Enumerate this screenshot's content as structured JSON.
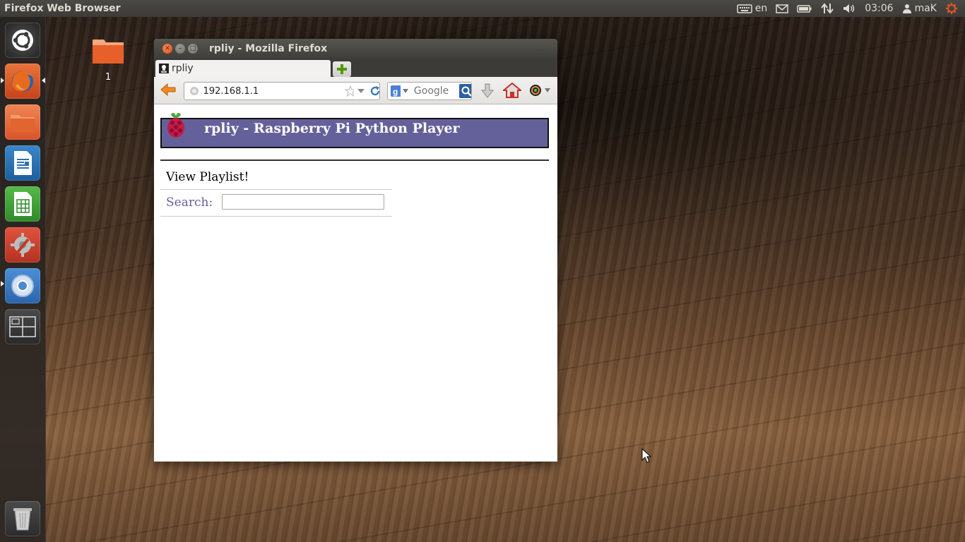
{
  "top_panel": {
    "app_name": "Firefox Web Browser",
    "keyboard_layout": "en",
    "time": "03:06",
    "user": "maK"
  },
  "launcher": {
    "items": [
      {
        "name": "dash-home",
        "running": false
      },
      {
        "name": "firefox",
        "running": true,
        "focused": true
      },
      {
        "name": "files",
        "running": false
      },
      {
        "name": "libreoffice-writer",
        "running": false
      },
      {
        "name": "libreoffice-calc",
        "running": false
      },
      {
        "name": "system-settings",
        "running": false
      },
      {
        "name": "chromium",
        "running": true
      },
      {
        "name": "workspace-switcher",
        "running": false
      },
      {
        "name": "trash",
        "running": false
      }
    ]
  },
  "desktop": {
    "folder_label": "1"
  },
  "window": {
    "title": "rpliy - Mozilla Firefox",
    "tab_label": "rpliy",
    "url": "192.168.1.1",
    "search_placeholder": "Google"
  },
  "page": {
    "heading": "rpliy - Raspberry Pi Python Player",
    "playlist_link": "View Playlist!",
    "search_label": "Search:",
    "search_value": ""
  },
  "colors": {
    "header_bar": "#64619a",
    "search_label": "#64619a",
    "close_button": "#df4a16"
  }
}
